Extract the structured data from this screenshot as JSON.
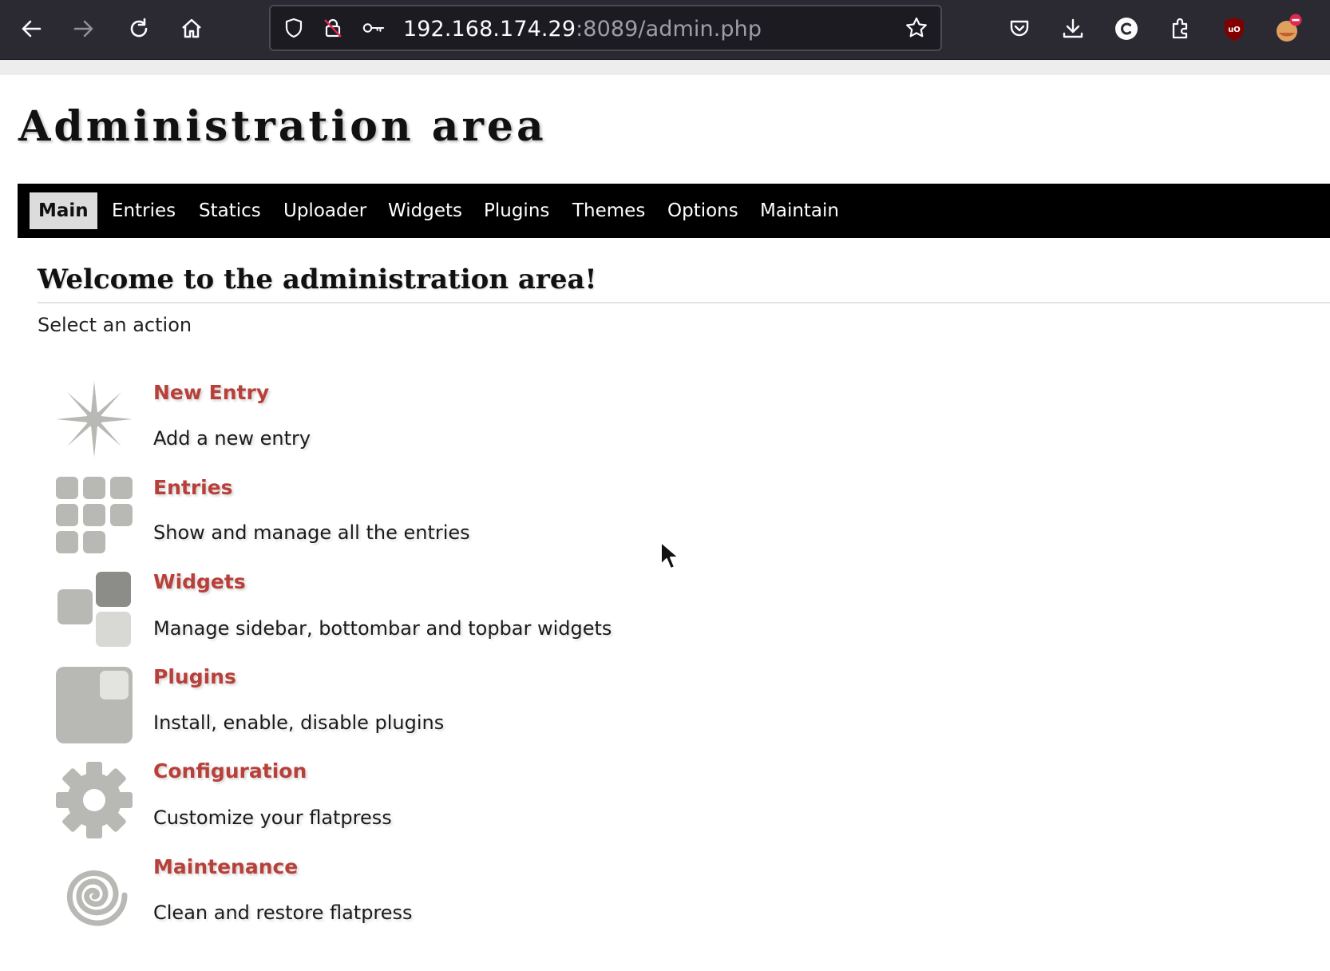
{
  "browser": {
    "url_host": "192.168.174.29",
    "url_rest": ":8089/admin.php",
    "buttons": [
      "back-icon",
      "forward-icon",
      "reload-icon",
      "home-icon"
    ],
    "extensions": [
      "pocket-icon",
      "download-icon",
      "extension-c-icon",
      "extensions-icon",
      "ublock-icon",
      "profile-icon"
    ]
  },
  "page": {
    "title": "Administration area",
    "nav": [
      {
        "label": "Main",
        "active": true
      },
      {
        "label": "Entries"
      },
      {
        "label": "Statics"
      },
      {
        "label": "Uploader"
      },
      {
        "label": "Widgets"
      },
      {
        "label": "Plugins"
      },
      {
        "label": "Themes"
      },
      {
        "label": "Options"
      },
      {
        "label": "Maintain"
      }
    ],
    "welcome": "Welcome to the administration area!",
    "intro": "Select an action",
    "actions": [
      {
        "title": "New Entry",
        "desc": "Add a new entry",
        "icon": "new-entry-star-icon"
      },
      {
        "title": "Entries",
        "desc": "Show and manage all the entries",
        "icon": "entries-grid-icon"
      },
      {
        "title": "Widgets",
        "desc": "Manage sidebar, bottombar and topbar widgets",
        "icon": "widgets-blocks-icon"
      },
      {
        "title": "Plugins",
        "desc": "Install, enable, disable plugins",
        "icon": "plugins-square-icon"
      },
      {
        "title": "Configuration",
        "desc": "Customize your flatpress",
        "icon": "configuration-gear-icon"
      },
      {
        "title": "Maintenance",
        "desc": "Clean and restore flatpress",
        "icon": "maintenance-spiral-icon"
      }
    ]
  },
  "colors": {
    "link": "#b8403a",
    "nav_bg": "#000000",
    "icon_gray": "#b8b9b4"
  }
}
